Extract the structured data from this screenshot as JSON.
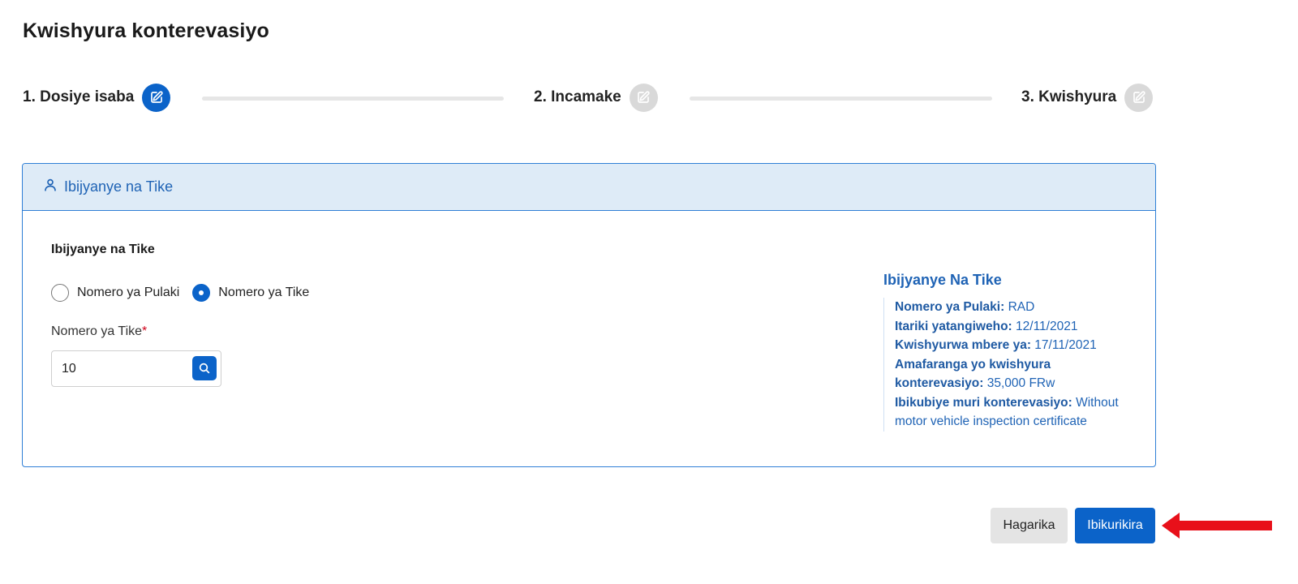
{
  "page": {
    "title": "Kwishyura konterevasiyo"
  },
  "stepper": {
    "steps": [
      {
        "label": "1. Dosiye isaba",
        "state": "active"
      },
      {
        "label": "2. Incamake",
        "state": "inactive"
      },
      {
        "label": "3. Kwishyura",
        "state": "inactive"
      }
    ],
    "icon": "edit-icon"
  },
  "panel": {
    "header_title": "Ibijyanye na Tike",
    "header_icon": "user-icon",
    "section_title": "Ibijyanye na Tike",
    "search_by": {
      "options": [
        "Nomero ya Pulaki",
        "Nomero ya Tike"
      ],
      "selected": "Nomero ya Tike"
    },
    "ticket_field": {
      "label": "Nomero ya Tike",
      "required_mark": "*",
      "value": "10",
      "search_icon": "search-icon"
    },
    "summary": {
      "title": "Ibijyanye Na Tike",
      "rows": [
        {
          "label": "Nomero ya Pulaki:",
          "value": "RAD"
        },
        {
          "label": "Itariki yatangiweho:",
          "value": "12/11/2021"
        },
        {
          "label": "Kwishyurwa mbere ya:",
          "value": "17/11/2021"
        },
        {
          "label": "Amafaranga yo kwishyura konterevasiyo:",
          "value": "35,000 FRw"
        },
        {
          "label": "Ibikubiye muri konterevasiyo:",
          "value": "Without motor vehicle inspection certificate"
        }
      ]
    }
  },
  "actions": {
    "cancel_label": "Hagarika",
    "next_label": "Ibikurikira"
  },
  "annotation": {
    "arrow_icon": "arrow-left-icon",
    "color": "#e8101a"
  },
  "colors": {
    "primary": "#0b63c9",
    "header_bg": "#deebf7",
    "summary_text": "#1f63b5"
  }
}
